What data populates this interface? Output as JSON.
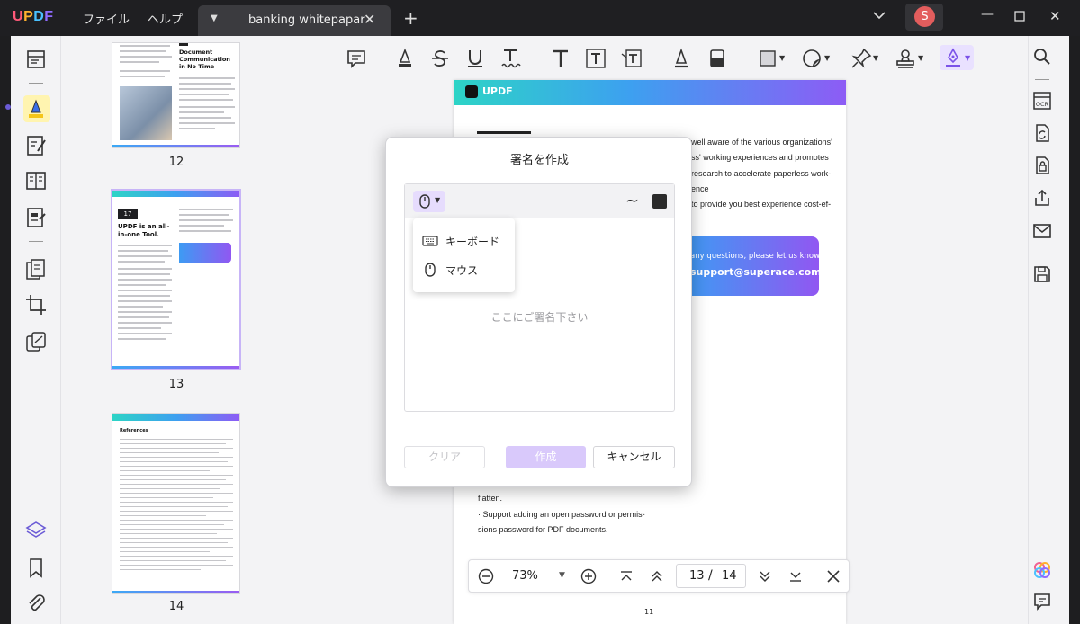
{
  "app": {
    "logo": [
      "U",
      "P",
      "D",
      "F"
    ],
    "menu": [
      "ファイル",
      "ヘルプ"
    ],
    "tab_title": "banking whitepapar",
    "avatar_initial": "S"
  },
  "thumbnails": [
    {
      "page": "12",
      "heading": "Document Communication in No Time"
    },
    {
      "page": "13",
      "badge": "17",
      "heading": "UPDF is an all-in-one Tool."
    },
    {
      "page": "14",
      "heading": "References"
    }
  ],
  "document": {
    "header_brand": "UPDF",
    "lines": [
      "well aware of the various organizations'",
      "ss' working experiences and promotes",
      "research to accelerate paperless work-",
      "ence",
      "to provide you best experience cost-ef-"
    ],
    "contact_line": "any questions, please let us know at",
    "contact_email": "support@superace.com.",
    "bottom_lines": [
      "flatten.",
      "· Support adding an open password or permis-",
      "sions password for PDF documents."
    ],
    "page_footer": "11"
  },
  "dialog": {
    "title": "署名を作成",
    "tilde": "~",
    "dropdown": {
      "keyboard_label": "キーボード",
      "mouse_label": "マウス"
    },
    "placeholder": "ここにご署名下さい",
    "buttons": {
      "clear": "クリア",
      "create": "作成",
      "cancel": "キャンセル"
    },
    "accent_color": "#d9c9fb",
    "stroke_color": "#2b2b2b"
  },
  "navigation": {
    "zoom": "73%",
    "current_page": "13",
    "separator": "/",
    "total_pages": "14"
  },
  "icons": {
    "top_toolbar": [
      "comment-icon",
      "highlight-icon",
      "strikethrough-icon",
      "underline-icon",
      "squiggly-icon",
      "text-icon",
      "textbox-icon",
      "text-callout-icon",
      "pencil-icon",
      "eraser-icon",
      "shape-icon",
      "sticker-icon",
      "pin-icon",
      "stamp-icon",
      "signature-pen-icon"
    ],
    "left_bar": [
      "reader-icon",
      "comment-mode-icon",
      "edit-icon",
      "organize-icon",
      "form-icon",
      "convert-icon",
      "crop-icon",
      "page-tools-icon",
      "layers-icon",
      "bookmark-icon",
      "attachment-icon"
    ],
    "right_bar": [
      "search-icon",
      "ocr-icon",
      "convert-icon",
      "protect-icon",
      "share-icon",
      "email-icon",
      "save-icon",
      "ai-icon",
      "chat-icon"
    ]
  }
}
